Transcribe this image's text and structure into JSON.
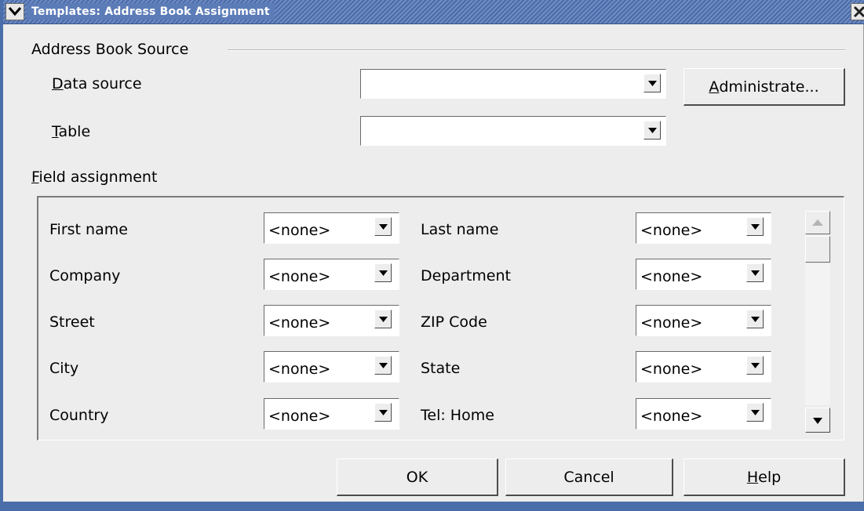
{
  "window": {
    "title": "Templates: Address Book Assignment"
  },
  "source_group": {
    "label": "Address Book Source",
    "data_source_label_u": "D",
    "data_source_label_rest": "ata source",
    "data_source_value": "",
    "table_label_u": "T",
    "table_label_rest": "able",
    "table_value": "",
    "administrate_u": "A",
    "administrate_rest": "dministrate..."
  },
  "field_assignment": {
    "label_u": "F",
    "label_rest": "ield assignment",
    "left_fields": [
      {
        "label": "First name",
        "value": "<none>"
      },
      {
        "label": "Company",
        "value": "<none>"
      },
      {
        "label": "Street",
        "value": "<none>"
      },
      {
        "label": "City",
        "value": "<none>"
      },
      {
        "label": "Country",
        "value": "<none>"
      }
    ],
    "right_fields": [
      {
        "label": "Last name",
        "value": "<none>"
      },
      {
        "label": "Department",
        "value": "<none>"
      },
      {
        "label": "ZIP Code",
        "value": "<none>"
      },
      {
        "label": "State",
        "value": "<none>"
      },
      {
        "label": "Tel: Home",
        "value": "<none>"
      }
    ]
  },
  "buttons": {
    "ok": "OK",
    "cancel": "Cancel",
    "help_u": "H",
    "help_rest": "elp"
  },
  "colors": {
    "titlebar": "#4b6ba8",
    "dialog_bg": "#ededed"
  }
}
